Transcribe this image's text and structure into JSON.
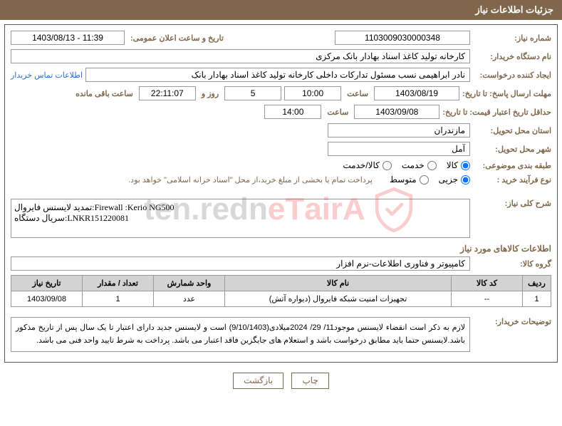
{
  "header": {
    "title": "جزئیات اطلاعات نیاز"
  },
  "need": {
    "number_label": "شماره نیاز:",
    "number": "1103009030000348",
    "ann_datetime_label": "تاریخ و ساعت اعلان عمومی:",
    "ann_datetime": "1403/08/13 - 11:39"
  },
  "buyer": {
    "org_label": "نام دستگاه خریدار:",
    "org": "کارخانه تولید کاغذ اسناد بهادار بانک مرکزی",
    "creator_label": "ایجاد کننده درخواست:",
    "creator": "نادر ابراهیمی نسب مسئول تدارکات داخلی کارخانه تولید کاغذ اسناد بهادار بانک",
    "contact_link": "اطلاعات تماس خریدار"
  },
  "deadline": {
    "respond_label": "مهلت ارسال پاسخ: تا تاریخ:",
    "respond_date": "1403/08/19",
    "time_label": "ساعت",
    "respond_time": "10:00",
    "days": "5",
    "days_between": "روز و",
    "remain_clock": "22:11:07",
    "remain_suffix": "ساعت باقی مانده"
  },
  "min_valid": {
    "label": "حداقل تاریخ اعتبار قیمت: تا تاریخ:",
    "date": "1403/09/08",
    "time_label": "ساعت",
    "time": "14:00"
  },
  "delivery": {
    "province_label": "استان محل تحویل:",
    "province": "مازندران",
    "city_label": "شهر محل تحویل:",
    "city": "آمل"
  },
  "category": {
    "label": "طبقه بندی موضوعی:",
    "goods": "کالا",
    "service": "خدمت",
    "goods_service": "کالا/خدمت"
  },
  "purchase_type": {
    "label": "نوع فرآیند خرید :",
    "partial": "جزیی",
    "medium": "متوسط",
    "note": "پرداخت تمام یا بخشی از مبلغ خرید،از محل \"اسناد خزانه اسلامی\" خواهد بود."
  },
  "summary": {
    "label": "شرح کلی نیاز:",
    "text": "تمدید لایسنس فایروال:Firewall :Kerio NG500\nسریال دستگاه:LNKR151220081"
  },
  "goods_info": {
    "title": "اطلاعات کالاهای مورد نیاز"
  },
  "group": {
    "label": "گروه کالا:",
    "value": "کامپیوتر و فناوری اطلاعات-نرم افزار"
  },
  "table": {
    "headers": {
      "row": "ردیف",
      "code": "کد کالا",
      "name": "نام کالا",
      "unit": "واحد شمارش",
      "qty": "تعداد / مقدار",
      "need_date": "تاریخ نیاز"
    },
    "rows": [
      {
        "row": "1",
        "code": "--",
        "name": "تجهیزات امنیت شبکه فایروال (دیواره آتش)",
        "unit": "عدد",
        "qty": "1",
        "need_date": "1403/09/08"
      }
    ]
  },
  "buyer_notes": {
    "label": "توضیحات خریدار:",
    "text": "لازم به ذکر است انقضاء لایسنس موجود11/ 29/ 2024میلادی(9/10/1403) است و لایسنس جدید دارای اعتبار تا یک سال پس از تاریخ مذکور باشد.لایسنس حتما باید مطابق درخواست باشد و استعلام های جایگزین فاقد اعتبار می باشد. پرداخت به شرط تایید واحد فنی می باشد."
  },
  "buttons": {
    "print": "چاپ",
    "back": "بازگشت"
  },
  "watermark": {
    "text": "AriaTender.net"
  }
}
